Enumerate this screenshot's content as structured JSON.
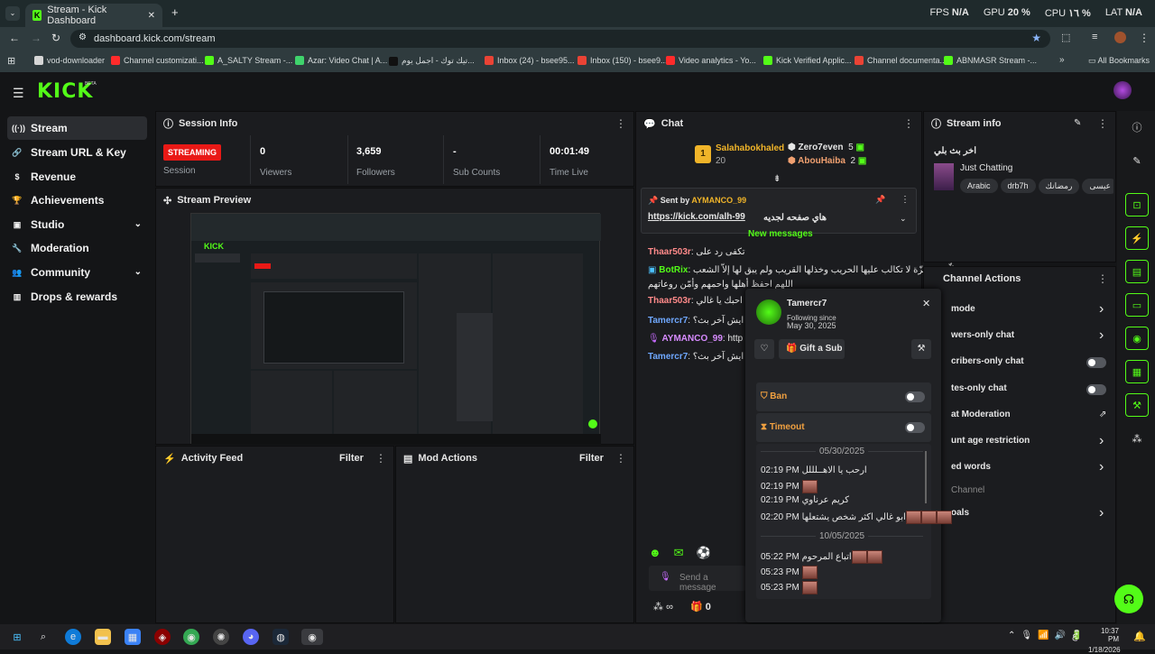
{
  "browser": {
    "tab_title": "Stream - Kick Dashboard",
    "url": "dashboard.kick.com/stream",
    "stats": {
      "fps_label": "FPS",
      "fps": "N/A",
      "gpu_label": "GPU",
      "gpu": "20 %",
      "cpu_label": "CPU",
      "cpu": "١٦ %",
      "lat_label": "LAT",
      "lat": "N/A"
    },
    "bookmarks": [
      {
        "label": "vod-downloader",
        "color": "#d6d6d6"
      },
      {
        "label": "Channel customizati...",
        "color": "#ff2b2b"
      },
      {
        "label": "A_SALTY Stream -...",
        "color": "#53fc18"
      },
      {
        "label": "Azar: Video Chat | A...",
        "color": "#3fd36c"
      },
      {
        "label": "تيك توك - اجمل يوم...",
        "color": "#111111"
      },
      {
        "label": "Inbox (24) - bsee95...",
        "color": "#ea4335"
      },
      {
        "label": "Inbox (150) - bsee9...",
        "color": "#ea4335"
      },
      {
        "label": "Video analytics - Yo...",
        "color": "#ff2b2b"
      },
      {
        "label": "Kick Verified Applic...",
        "color": "#53fc18"
      },
      {
        "label": "Channel documenta...",
        "color": "#ea4335"
      },
      {
        "label": "ABNMASR Stream -...",
        "color": "#53fc18"
      }
    ],
    "all_bookmarks": "All Bookmarks"
  },
  "brand": {
    "logo": "KICK",
    "beta": "BETA",
    "accent": "#53fc18"
  },
  "sidebar": {
    "items": [
      {
        "label": "Stream",
        "icon": "broadcast-icon"
      },
      {
        "label": "Stream URL & Key",
        "icon": "link-icon"
      },
      {
        "label": "Revenue",
        "icon": "dollar-icon"
      },
      {
        "label": "Achievements",
        "icon": "trophy-icon"
      },
      {
        "label": "Studio",
        "icon": "studio-icon"
      },
      {
        "label": "Moderation",
        "icon": "wrench-icon"
      },
      {
        "label": "Community",
        "icon": "people-icon"
      },
      {
        "label": "Drops & rewards",
        "icon": "chart-icon"
      }
    ]
  },
  "session": {
    "title": "Session Info",
    "status": "STREAMING",
    "status_label": "Session",
    "viewers": "0",
    "viewers_label": "Viewers",
    "followers": "3,659",
    "followers_label": "Followers",
    "subs": "-",
    "subs_label": "Sub Counts",
    "time": "00:01:49",
    "time_label": "Time Live"
  },
  "preview": {
    "title": "Stream Preview"
  },
  "activity": {
    "title": "Activity Feed",
    "filter": "Filter"
  },
  "modactions": {
    "title": "Mod Actions",
    "filter": "Filter"
  },
  "chat": {
    "title": "Chat",
    "leaders": [
      {
        "rank": "1",
        "name": "Salahabokhaled",
        "count": "20"
      },
      {
        "name": "Zero7even",
        "count": "5"
      },
      {
        "name": "AbouHaiba",
        "count": "2"
      }
    ],
    "pinned": {
      "sent_by": "Sent by",
      "user": "AYMANCO_99",
      "link": "https://kick.com/alh-99",
      "text": "هاي صفحه لجديه"
    },
    "new_messages": "New messages",
    "messages": [
      {
        "user": "Thaar503r",
        "text": "تكفى رد على",
        "cls": "r"
      },
      {
        "user": "BotRix",
        "text": "الّهم عـــزّة لا تكالب عليها الحريب وخذلها القريب ولم يبق لها إلاّ الشعب",
        "cls": "g"
      },
      {
        "user": "",
        "text": "اللهم احفظ أهلها واحمهم وأمّن روعاتهم",
        "cls": "g"
      },
      {
        "user": "Thaar503r",
        "text": "اني احبك يا غالي",
        "cls": "r"
      },
      {
        "user": "Tamercr7",
        "text": "ايش آخر بث؟",
        "cls": "b"
      },
      {
        "user": "AYMANCO_99",
        "text": "http",
        "cls": "p"
      },
      {
        "user": "Tamercr7",
        "text": "ايش آخر بث؟",
        "cls": "b"
      }
    ],
    "input_placeholder": "Send a message",
    "infinity": "∞",
    "gift_count": "0"
  },
  "popup": {
    "user": "Tamercr7",
    "following_label": "Following since",
    "following_date": "May 30, 2025",
    "gift_label": "Gift a Sub",
    "ban_label": "Ban",
    "timeout_label": "Timeout",
    "history": [
      {
        "date": "05/30/2025"
      },
      {
        "time": "02:19 PM",
        "text": "ارحب يا الاهــلللل",
        "emotes": 0
      },
      {
        "time": "02:19 PM",
        "text": "",
        "emotes": 1
      },
      {
        "time": "02:19 PM",
        "text": "كريم عرناوي",
        "emotes": 0
      },
      {
        "time": "02:20 PM",
        "text": "ابو غالي اكثر شخص يشتعلها",
        "emotes": 3
      },
      {
        "date": "10/05/2025"
      },
      {
        "time": "05:22 PM",
        "text": "اتباع المرحوم",
        "emotes": 2
      },
      {
        "time": "05:23 PM",
        "text": "",
        "emotes": 1
      },
      {
        "time": "05:23 PM",
        "text": "",
        "emotes": 1
      }
    ]
  },
  "stream_info": {
    "title": "Stream info",
    "stream_title": "اخر بث بلي",
    "category": "Just Chatting",
    "tags": [
      "Arabic",
      "drb7h",
      "رمضانك",
      "عيسى",
      "بي"
    ]
  },
  "channel_actions": {
    "title": "Channel Actions",
    "items": [
      {
        "label": "mode",
        "ctl": "arrow"
      },
      {
        "label": "wers-only chat",
        "ctl": "arrow"
      },
      {
        "label": "cribers-only chat",
        "ctl": "toggle"
      },
      {
        "label": "tes-only chat",
        "ctl": "toggle"
      },
      {
        "label": "at Moderation",
        "ctl": "ext"
      },
      {
        "label": "unt age restriction",
        "ctl": "arrow"
      },
      {
        "label": "ed words",
        "ctl": "arrow"
      },
      {
        "label": "Channel",
        "ctl": "none"
      },
      {
        "label": "oals",
        "ctl": "arrow"
      }
    ]
  },
  "taskbar": {
    "time": "10:37 PM",
    "date": "1/18/2026",
    "lang": "ع"
  }
}
